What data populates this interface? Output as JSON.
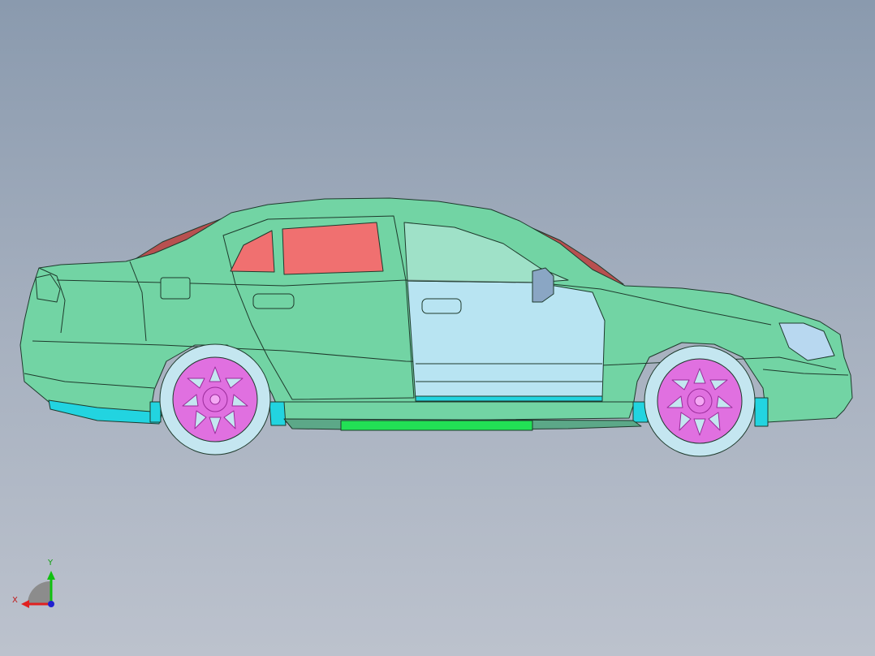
{
  "triad": {
    "x_label": "X",
    "y_label": "Y"
  },
  "colors": {
    "body": "#72d4a4",
    "body_stroke": "#1e3a2c",
    "glass": "#f07070",
    "glass_rear": "#b85050",
    "door": "#b8e4f2",
    "tire": "#c4e6f0",
    "rim": "#e070e0",
    "rim_dark": "#9a2c9a",
    "sill": "#22e055",
    "cyan_parts": "#22d4e0",
    "axis_x": "#e02020",
    "axis_y": "#10c010",
    "axis_z": "#2020d0"
  }
}
